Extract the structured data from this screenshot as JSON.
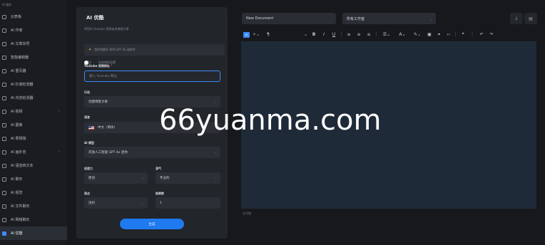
{
  "sidebar": {
    "header": "AI 服务",
    "items": [
      {
        "label": "仪表板",
        "chevron": false,
        "active": false
      },
      {
        "label": "AI 作家",
        "chevron": false,
        "active": false
      },
      {
        "label": "AI 文章向导",
        "chevron": false,
        "active": false
      },
      {
        "label": "智能编辑器",
        "chevron": false,
        "active": false
      },
      {
        "label": "AI 重写器",
        "chevron": false,
        "active": false
      },
      {
        "label": "AI 抄袭检测器",
        "chevron": false,
        "active": false
      },
      {
        "label": "AI 内容检测器",
        "chevron": false,
        "active": false
      },
      {
        "label": "AI 视频",
        "chevron": true,
        "active": false
      },
      {
        "label": "AI 图像",
        "chevron": false,
        "active": false
      },
      {
        "label": "AI 照相馆",
        "chevron": false,
        "active": false
      },
      {
        "label": "AI 画外音",
        "chevron": true,
        "active": false
      },
      {
        "label": "AI 语音转文本",
        "chevron": false,
        "active": false
      },
      {
        "label": "AI 聊天",
        "chevron": false,
        "active": false
      },
      {
        "label": "AI 视觉",
        "chevron": false,
        "active": false
      },
      {
        "label": "AI 文件聊天",
        "chevron": false,
        "active": false
      },
      {
        "label": "AI 网络聊天",
        "chevron": false,
        "active": false
      },
      {
        "label": "AI 优酷",
        "chevron": false,
        "active": true
      }
    ]
  },
  "form": {
    "title": "AI 优酷",
    "subtitle": "将您的 Youtube 视频变成博客文章",
    "credits": "您的余额为 800 GPT 4o 迷你字",
    "toggle_label": "包含您的品牌",
    "url_label": "Youtube 视频网址",
    "url_placeholder": "输入 Youtube 网址",
    "action_label": "行动",
    "action_value": "创建博客文章",
    "language_label": "语言",
    "language_value": "中文（简体）",
    "model_label": "AI 模型",
    "model_value": "开放人工智能 GPT 4o 迷你",
    "creativity_label": "创造力",
    "creativity_value": "原创",
    "tone_label": "语气",
    "tone_value": "专业的",
    "points_label": "观点",
    "points_value": "违约",
    "results_label": "结果数",
    "results_value": "1",
    "generate_button": "生成"
  },
  "editor": {
    "document_name": "New Document",
    "workspace": "所有工作室",
    "word_count_label": "总字数:",
    "toolbar": [
      "AI",
      "magic-wand-icon",
      "paragraph-icon",
      "bold",
      "italic",
      "underline",
      "align-left",
      "align-center",
      "align-right",
      "list-icon",
      "font-color-icon",
      "highlight-icon",
      "image-icon",
      "link-icon",
      "code-icon",
      "quote-icon",
      "undo-icon",
      "redo-icon"
    ]
  },
  "watermark": "66yuanma.com",
  "colors": {
    "accent": "#1f7af0",
    "editor_bg": "#1f2a38",
    "panel_bg": "#22252a"
  }
}
